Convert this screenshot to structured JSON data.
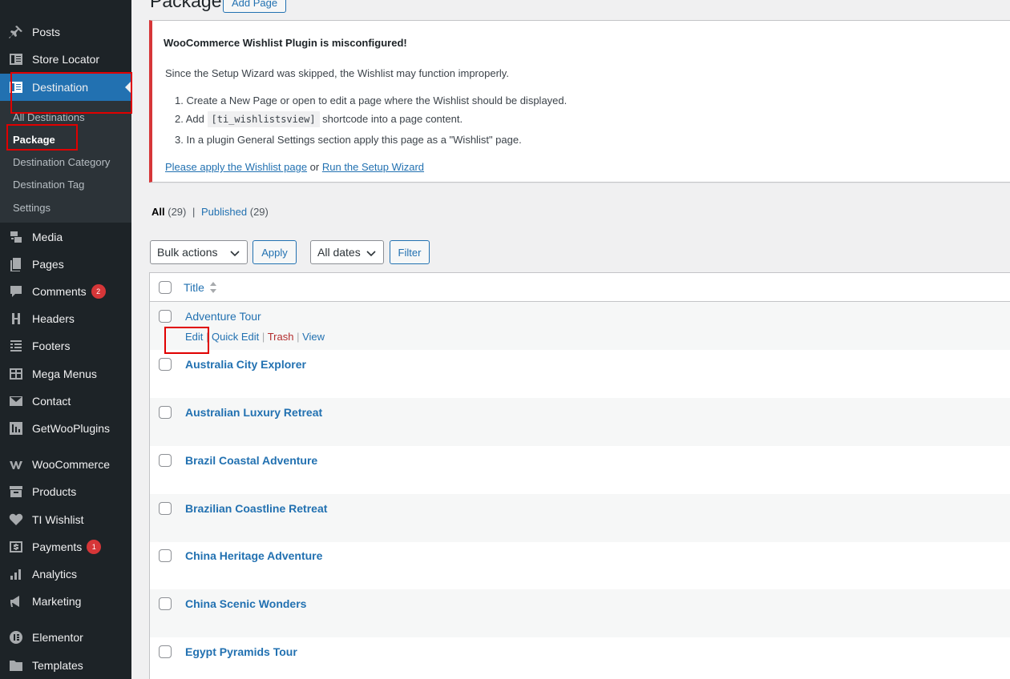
{
  "sidebar": {
    "items": [
      {
        "label": "Posts",
        "icon": "pin-icon"
      },
      {
        "label": "Store Locator",
        "icon": "store-icon"
      },
      {
        "label": "Destination",
        "icon": "destination-icon"
      },
      {
        "label": "Media",
        "icon": "media-icon"
      },
      {
        "label": "Pages",
        "icon": "pages-icon"
      },
      {
        "label": "Comments",
        "icon": "comments-icon",
        "badge": "2"
      },
      {
        "label": "Headers",
        "icon": "headers-icon"
      },
      {
        "label": "Footers",
        "icon": "footers-icon"
      },
      {
        "label": "Mega Menus",
        "icon": "table-icon"
      },
      {
        "label": "Contact",
        "icon": "mail-icon"
      },
      {
        "label": "GetWooPlugins",
        "icon": "plugins-icon"
      },
      {
        "label": "WooCommerce",
        "icon": "woocommerce-icon"
      },
      {
        "label": "Products",
        "icon": "archive-icon"
      },
      {
        "label": "TI Wishlist",
        "icon": "heart-icon"
      },
      {
        "label": "Payments",
        "icon": "dollar-icon",
        "badge": "1"
      },
      {
        "label": "Analytics",
        "icon": "chart-icon"
      },
      {
        "label": "Marketing",
        "icon": "megaphone-icon"
      },
      {
        "label": "Elementor",
        "icon": "elementor-icon"
      },
      {
        "label": "Templates",
        "icon": "folder-icon"
      }
    ],
    "submenu": [
      "All Destinations",
      "Package",
      "Destination Category",
      "Destination Tag",
      "Settings"
    ]
  },
  "header": {
    "title": "Package",
    "add_button": "Add Page"
  },
  "notice": {
    "title": "WooCommerce Wishlist Plugin is misconfigured!",
    "desc": "Since the Setup Wizard was skipped, the Wishlist may function improperly.",
    "step1": "1. Create a New Page or open to edit a page where the Wishlist should be displayed.",
    "step2_pre": "2. Add",
    "step2_code": "[ti_wishlistsview]",
    "step2_post": "shortcode into a page content.",
    "step3": "3. In a plugin General Settings section apply this page as a \"Wishlist\" page.",
    "link1": "Please apply the Wishlist page",
    "or": "or",
    "link2": "Run the Setup Wizard"
  },
  "filters": {
    "all": "All",
    "all_count": "(29)",
    "sep": "|",
    "published": "Published",
    "published_count": "(29)"
  },
  "tablenav": {
    "bulk": "Bulk actions",
    "apply": "Apply",
    "dates": "All dates",
    "filter": "Filter"
  },
  "table": {
    "col_title": "Title",
    "rows": [
      "Adventure Tour",
      "Australia City Explorer",
      "Australian Luxury Retreat",
      "Brazil Coastal Adventure",
      "Brazilian Coastline Retreat",
      "China Heritage Adventure",
      "China Scenic Wonders",
      "Egypt Pyramids Tour"
    ],
    "row_actions": {
      "edit": "Edit",
      "quick_edit": "Quick Edit",
      "trash": "Trash",
      "view": "View",
      "sep": "|"
    }
  },
  "colors": {
    "sidebar_bg": "#1d2327",
    "accent": "#2271b1",
    "error": "#d63638",
    "highlight": "#e00000"
  }
}
